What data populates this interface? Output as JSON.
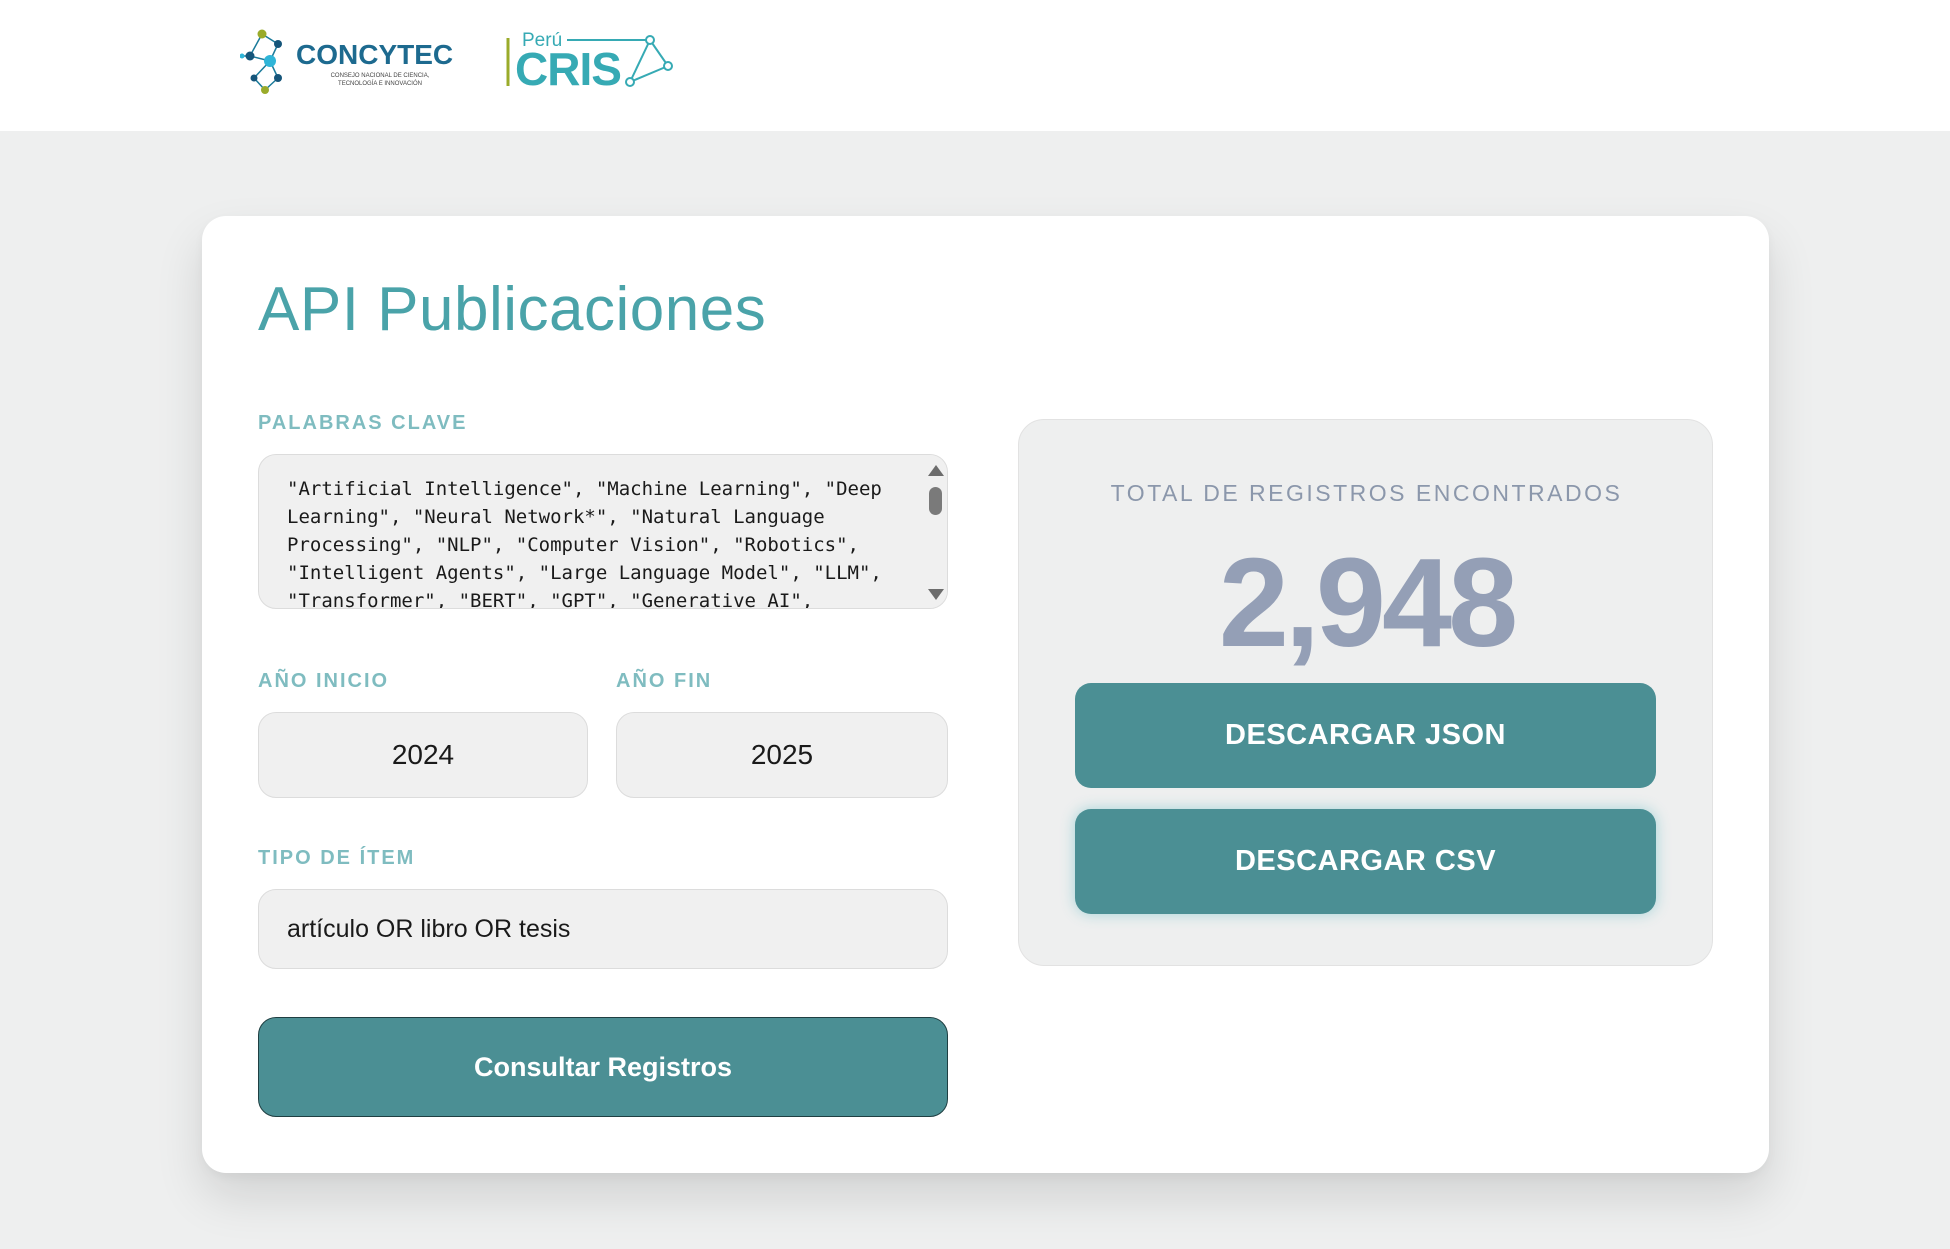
{
  "header": {
    "logo_concytec": {
      "name": "CONCYTEC",
      "tagline_1": "CONSEJO NACIONAL DE CIENCIA,",
      "tagline_2": "TECNOLOGÍA E INNOVACIÓN"
    },
    "logo_cris": {
      "prefix": "Perú",
      "name": "CRIS"
    }
  },
  "main": {
    "title": "API Publicaciones",
    "keywords": {
      "label": "PALABRAS CLAVE",
      "value": "\"Artificial Intelligence\", \"Machine Learning\", \"Deep Learning\", \"Neural Network*\", \"Natural Language Processing\", \"NLP\", \"Computer Vision\", \"Robotics\", \"Intelligent Agents\", \"Large Language Model\", \"LLM\", \"Transformer\", \"BERT\", \"GPT\", \"Generative AI\","
    },
    "year_start": {
      "label": "AÑO INICIO",
      "value": "2024"
    },
    "year_end": {
      "label": "AÑO FIN",
      "value": "2025"
    },
    "item_type": {
      "label": "TIPO DE ÍTEM",
      "value": "artículo OR libro OR tesis"
    },
    "submit_label": "Consultar Registros"
  },
  "results": {
    "label": "TOTAL DE REGISTROS ENCONTRADOS",
    "total": "2,948",
    "download_json_label": "DESCARGAR JSON",
    "download_csv_label": "DESCARGAR CSV"
  },
  "colors": {
    "accent": "#4b8f94",
    "title": "#4aa3a9",
    "label": "#7fbcc0",
    "count": "#949fb6",
    "background": "#eeefef"
  }
}
